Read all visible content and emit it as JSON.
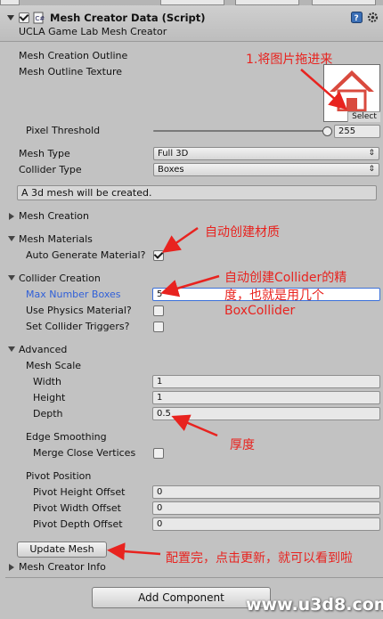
{
  "header": {
    "title": "Mesh Creator Data (Script)",
    "subtitle": "UCLA Game Lab Mesh Creator"
  },
  "texture": {
    "outline_label": "Mesh Creation Outline",
    "texture_label": "Mesh Outline Texture",
    "select_label": "Select"
  },
  "pixel_threshold": {
    "label": "Pixel Threshold",
    "value": "255",
    "slider_fraction": 1.0
  },
  "mesh_type": {
    "label": "Mesh Type",
    "value": "Full 3D"
  },
  "collider_type": {
    "label": "Collider Type",
    "value": "Boxes"
  },
  "help_box": "A 3d mesh will be created.",
  "sections": {
    "mesh_creation": "Mesh Creation",
    "mesh_materials": "Mesh Materials",
    "auto_generate": "Auto Generate Material?",
    "collider_creation": "Collider Creation",
    "max_boxes_label": "Max Number Boxes",
    "max_boxes_value": "5",
    "use_physics": "Use Physics Material?",
    "set_triggers": "Set Collider Triggers?",
    "advanced": "Advanced",
    "mesh_scale": "Mesh Scale",
    "width_label": "Width",
    "width_value": "1",
    "height_label": "Height",
    "height_value": "1",
    "depth_label": "Depth",
    "depth_value": "0.5",
    "edge_smoothing": "Edge Smoothing",
    "merge_close": "Merge Close Vertices",
    "pivot_position": "Pivot Position",
    "pivot_height_label": "Pivot Height Offset",
    "pivot_height_value": "0",
    "pivot_width_label": "Pivot Width Offset",
    "pivot_width_value": "0",
    "pivot_depth_label": "Pivot Depth Offset",
    "pivot_depth_value": "0",
    "update_mesh": "Update Mesh",
    "mesh_creator_info": "Mesh Creator Info"
  },
  "add_component": "Add Component",
  "annotations": {
    "a1": "1.将图片拖进来",
    "a2": "自动创建材质",
    "a3_line1": "自动创建Collider的精",
    "a3_line2": "度，也就是用几个",
    "a3_line3": "BoxCollider",
    "a4": "厚度",
    "a5": "配置完，点击更新，就可以看到啦"
  },
  "watermark": "www.u3d8.com",
  "colors": {
    "annotation_red": "#e8231f",
    "highlight_blue": "#2f5fd8",
    "inspector_bg": "#c2c2c2"
  }
}
